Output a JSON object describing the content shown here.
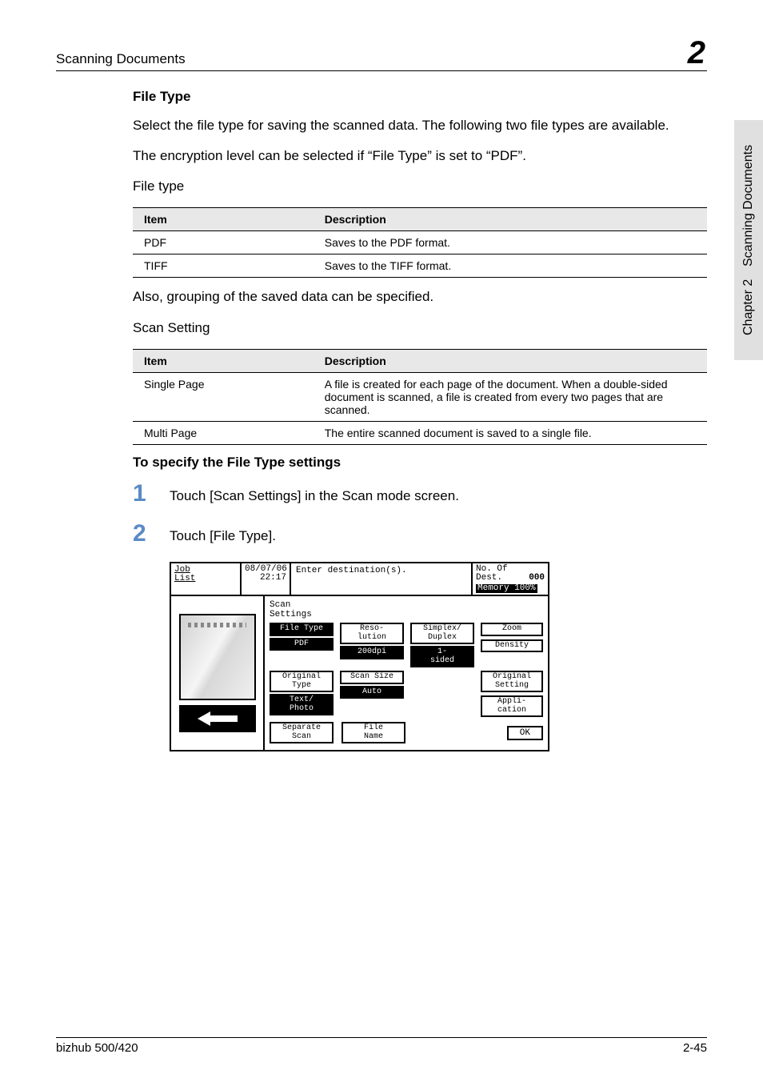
{
  "header": {
    "breadcrumb": "Scanning Documents",
    "chapter_num": "2"
  },
  "sidetab": {
    "section": "Scanning Documents",
    "chapter": "Chapter 2"
  },
  "sections": {
    "file_type_heading": "File Type",
    "file_type_intro": "Select the file type for saving the scanned data. The following two file types are available.",
    "encryption_note": "The encryption level can be selected if “File Type” is set to “PDF”.",
    "file_type_label": "File type",
    "grouping_note": "Also, grouping of the saved data can be specified.",
    "scan_setting_label": "Scan Setting",
    "specify_heading": "To specify the File Type settings"
  },
  "table_filetype": {
    "col_item": "Item",
    "col_desc": "Description",
    "rows": [
      {
        "item": "PDF",
        "desc": "Saves to the PDF format."
      },
      {
        "item": "TIFF",
        "desc": "Saves to the TIFF format."
      }
    ]
  },
  "table_scansetting": {
    "col_item": "Item",
    "col_desc": "Description",
    "rows": [
      {
        "item": "Single Page",
        "desc": "A file is created for each page of the document. When a double-sided document is scanned, a file is created from every two pages that are scanned."
      },
      {
        "item": "Multi Page",
        "desc": "The entire scanned document is saved to a single file."
      }
    ]
  },
  "steps": {
    "s1_num": "1",
    "s1_txt": "Touch [Scan Settings] in the Scan mode screen.",
    "s2_num": "2",
    "s2_txt": "Touch [File Type]."
  },
  "screenshot": {
    "job_list": "Job\nList",
    "date": "08/07/06",
    "time": "22:17",
    "title": "Enter destination(s).",
    "no_of": "No. Of\nDest.",
    "dest_count": "000",
    "memory": "Memory 100%",
    "scan_settings": "Scan\nSettings",
    "file_type_btn": "File Type",
    "file_type_val": "PDF",
    "reso_btn": "Reso-\nlution",
    "reso_val": "200dpi",
    "simplex_btn": "Simplex/\nDuplex",
    "simplex_val": "1-\nsided",
    "orig_type_btn": "Original\nType",
    "orig_type_val": "Text/\nPhoto",
    "scan_size_btn": "Scan Size",
    "scan_size_val": "Auto",
    "zoom": "Zoom",
    "density": "Density",
    "orig_setting": "Original\nSetting",
    "application": "Appli-\ncation",
    "separate": "Separate\nScan",
    "file_name": "File\nName",
    "ok": "OK"
  },
  "footer": {
    "left": "bizhub 500/420",
    "right": "2-45"
  }
}
